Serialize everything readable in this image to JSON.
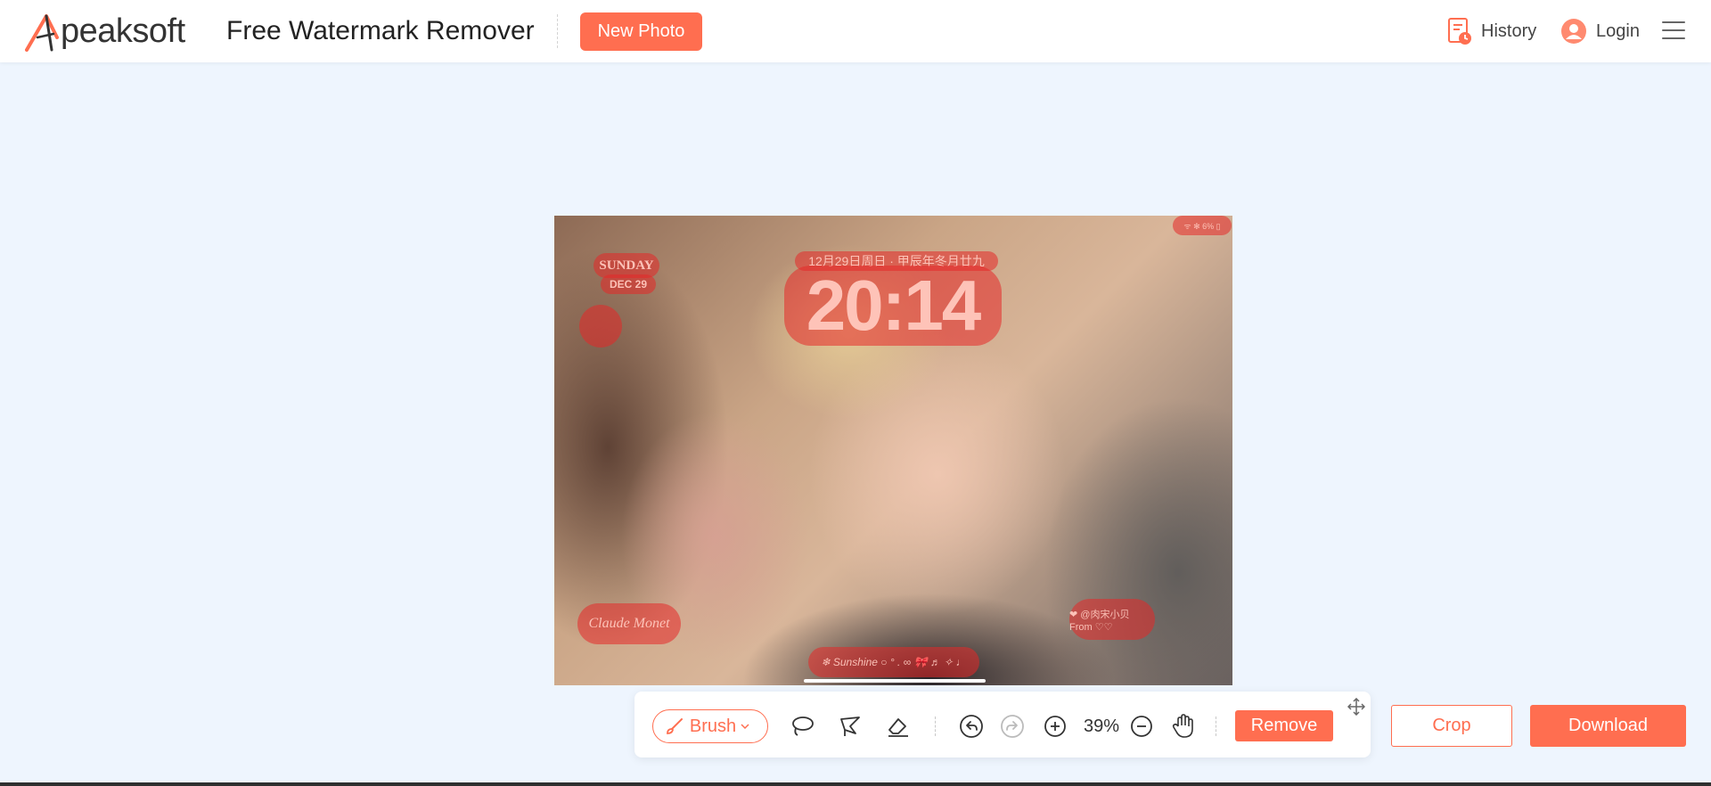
{
  "header": {
    "logo_text": "peaksoft",
    "app_title": "Free Watermark Remover",
    "new_photo_label": "New Photo",
    "history_label": "History",
    "login_label": "Login"
  },
  "photo": {
    "overlay_sunday": "SUNDAY",
    "overlay_dec": "DEC 29",
    "overlay_date": "12月29日周日 · 甲辰年冬月廿九",
    "overlay_time": "20:14",
    "overlay_status": "ᯤ ✻ 6% ▯",
    "overlay_signature": "Claude Monet",
    "overlay_sunshine": "❄ Sunshine ○ ° . ∞ 🎀 ♬ ✧ ♩",
    "overlay_stamp": "❤ @肉宋小贝 From ♡♡"
  },
  "toolbar": {
    "brush_label": "Brush",
    "zoom_value": "39%",
    "remove_label": "Remove"
  },
  "actions": {
    "crop_label": "Crop",
    "download_label": "Download"
  },
  "colors": {
    "accent": "#ff6e50",
    "background": "#eef5fe"
  }
}
